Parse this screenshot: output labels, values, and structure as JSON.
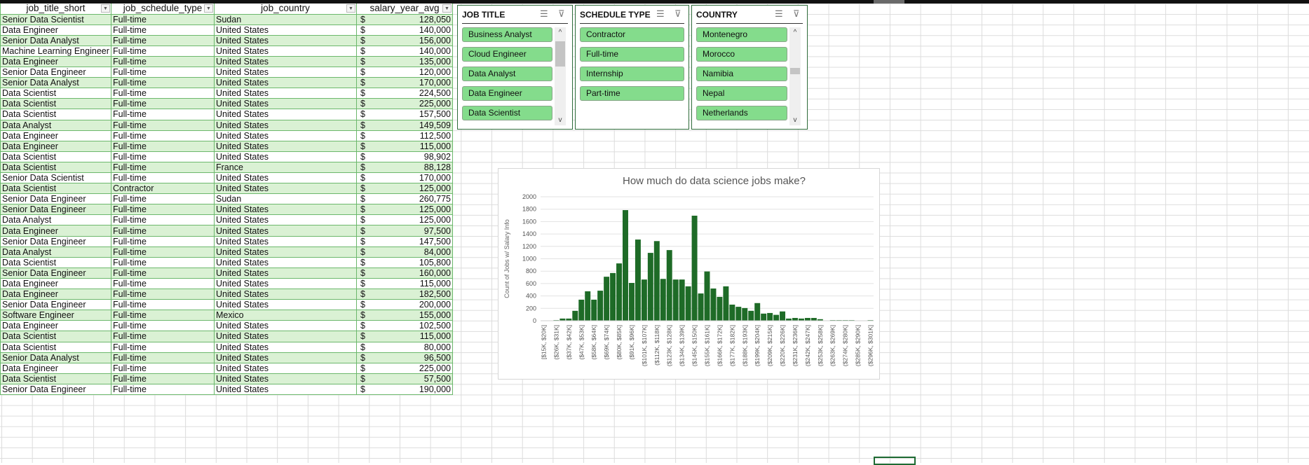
{
  "table": {
    "headers": [
      "job_title_short",
      "job_schedule_type",
      "job_country",
      "salary_year_avg"
    ],
    "currency": "$",
    "rows": [
      [
        "Senior Data Scientist",
        "Full-time",
        "Sudan",
        "128,050"
      ],
      [
        "Data Engineer",
        "Full-time",
        "United States",
        "140,000"
      ],
      [
        "Senior Data Analyst",
        "Full-time",
        "United States",
        "156,000"
      ],
      [
        "Machine Learning Engineer",
        "Full-time",
        "United States",
        "140,000"
      ],
      [
        "Data Engineer",
        "Full-time",
        "United States",
        "135,000"
      ],
      [
        "Senior Data Engineer",
        "Full-time",
        "United States",
        "120,000"
      ],
      [
        "Senior Data Analyst",
        "Full-time",
        "United States",
        "170,000"
      ],
      [
        "Data Scientist",
        "Full-time",
        "United States",
        "224,500"
      ],
      [
        "Data Scientist",
        "Full-time",
        "United States",
        "225,000"
      ],
      [
        "Data Scientist",
        "Full-time",
        "United States",
        "157,500"
      ],
      [
        "Data Analyst",
        "Full-time",
        "United States",
        "149,509"
      ],
      [
        "Data Engineer",
        "Full-time",
        "United States",
        "112,500"
      ],
      [
        "Data Engineer",
        "Full-time",
        "United States",
        "115,000"
      ],
      [
        "Data Scientist",
        "Full-time",
        "United States",
        "98,902"
      ],
      [
        "Data Scientist",
        "Full-time",
        "France",
        "88,128"
      ],
      [
        "Senior Data Scientist",
        "Full-time",
        "United States",
        "170,000"
      ],
      [
        "Data Scientist",
        "Contractor",
        "United States",
        "125,000"
      ],
      [
        "Senior Data Engineer",
        "Full-time",
        "Sudan",
        "260,775"
      ],
      [
        "Senior Data Engineer",
        "Full-time",
        "United States",
        "125,000"
      ],
      [
        "Data Analyst",
        "Full-time",
        "United States",
        "125,000"
      ],
      [
        "Data Engineer",
        "Full-time",
        "United States",
        "97,500"
      ],
      [
        "Senior Data Engineer",
        "Full-time",
        "United States",
        "147,500"
      ],
      [
        "Data Analyst",
        "Full-time",
        "United States",
        "84,000"
      ],
      [
        "Data Scientist",
        "Full-time",
        "United States",
        "105,800"
      ],
      [
        "Senior Data Engineer",
        "Full-time",
        "United States",
        "160,000"
      ],
      [
        "Data Engineer",
        "Full-time",
        "United States",
        "115,000"
      ],
      [
        "Data Engineer",
        "Full-time",
        "United States",
        "182,500"
      ],
      [
        "Senior Data Engineer",
        "Full-time",
        "United States",
        "200,000"
      ],
      [
        "Software Engineer",
        "Full-time",
        "Mexico",
        "155,000"
      ],
      [
        "Data Engineer",
        "Full-time",
        "United States",
        "102,500"
      ],
      [
        "Data Scientist",
        "Full-time",
        "United States",
        "115,000"
      ],
      [
        "Data Scientist",
        "Full-time",
        "United States",
        "80,000"
      ],
      [
        "Senior Data Analyst",
        "Full-time",
        "United States",
        "96,500"
      ],
      [
        "Data Engineer",
        "Full-time",
        "United States",
        "225,000"
      ],
      [
        "Data Scientist",
        "Full-time",
        "United States",
        "57,500"
      ],
      [
        "Senior Data Engineer",
        "Full-time",
        "United States",
        "190,000"
      ]
    ]
  },
  "slicers": [
    {
      "title": "JOB TITLE",
      "items": [
        "Business Analyst",
        "Cloud Engineer",
        "Data Analyst",
        "Data Engineer",
        "Data Scientist"
      ]
    },
    {
      "title": "SCHEDULE TYPE",
      "items": [
        "Contractor",
        "Full-time",
        "Internship",
        "Part-time"
      ]
    },
    {
      "title": "COUNTRY",
      "items": [
        "Montenegro",
        "Morocco",
        "Namibia",
        "Nepal",
        "Netherlands"
      ]
    }
  ],
  "chart_data": {
    "type": "bar",
    "title": "How much do data science jobs make?",
    "xlabel": "",
    "ylabel": "Count of Jobs w/ Salary Info",
    "ylim": [
      0,
      2000
    ],
    "yticks": [
      0,
      200,
      400,
      600,
      800,
      1000,
      1200,
      1400,
      1600,
      1800,
      2000
    ],
    "bar_color": "#1e6b27",
    "grid": true,
    "tick_labels": [
      "[$15K, $20K]",
      "($26K, $31K]",
      "($37K, $42K]",
      "($47K, $53K]",
      "($58K, $64K]",
      "($69K, $74K]",
      "($80K, $85K]",
      "($91K, $96K]",
      "($101K, $107K]",
      "($112K, $118K]",
      "($123K, $128K]",
      "($134K, $139K]",
      "($145K, $150K]",
      "($155K, $161K]",
      "($166K, $172K]",
      "($177K, $182K]",
      "($188K, $193K]",
      "($199K, $204K]",
      "($209K, $215K]",
      "($220K, $226K]",
      "($231K, $236K]",
      "($242K, $247K]",
      "($253K, $258K]",
      "($263K, $269K]",
      "($274K, $280K]",
      "($285K, $290K]",
      "($296K, $301K]"
    ],
    "values": [
      0,
      0,
      10,
      35,
      35,
      160,
      340,
      475,
      340,
      485,
      710,
      770,
      925,
      1785,
      610,
      1310,
      665,
      1095,
      1285,
      675,
      1140,
      665,
      665,
      555,
      1695,
      440,
      795,
      520,
      385,
      555,
      260,
      225,
      205,
      160,
      285,
      115,
      125,
      95,
      150,
      35,
      45,
      35,
      45,
      45,
      25,
      0,
      10,
      10,
      10,
      10,
      0,
      0,
      10
    ]
  }
}
